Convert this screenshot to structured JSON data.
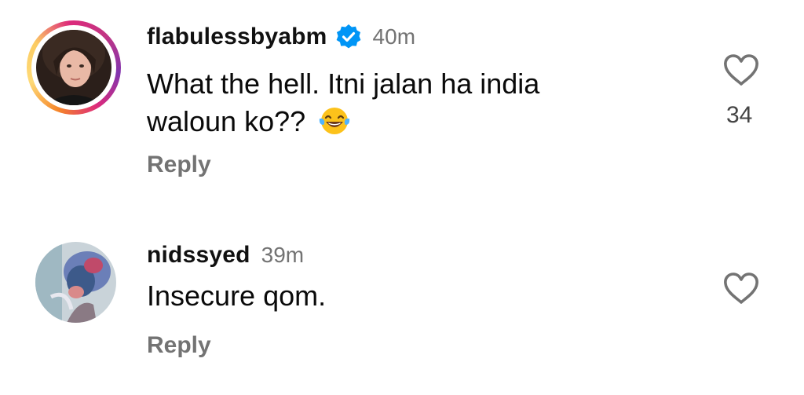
{
  "comments": [
    {
      "username": "flabulessbyabm",
      "time": "40m",
      "text": "What the hell. Itni jalan ha india waloun ko??",
      "reply_label": "Reply",
      "like_count": "34",
      "verified": true,
      "has_story_ring": true
    },
    {
      "username": "nidssyed",
      "time": "39m",
      "text": "Insecure qom.",
      "reply_label": "Reply",
      "verified": false,
      "has_story_ring": false
    }
  ],
  "icons": {
    "like": "heart-outline-icon",
    "verified": "verified-badge-icon",
    "emoji": "face-with-tears-of-joy"
  },
  "colors": {
    "verified_blue": "#0095f6",
    "secondary_text": "#737373",
    "story_ring": [
      "#f58529",
      "#dd2a7b",
      "#8134af"
    ]
  }
}
